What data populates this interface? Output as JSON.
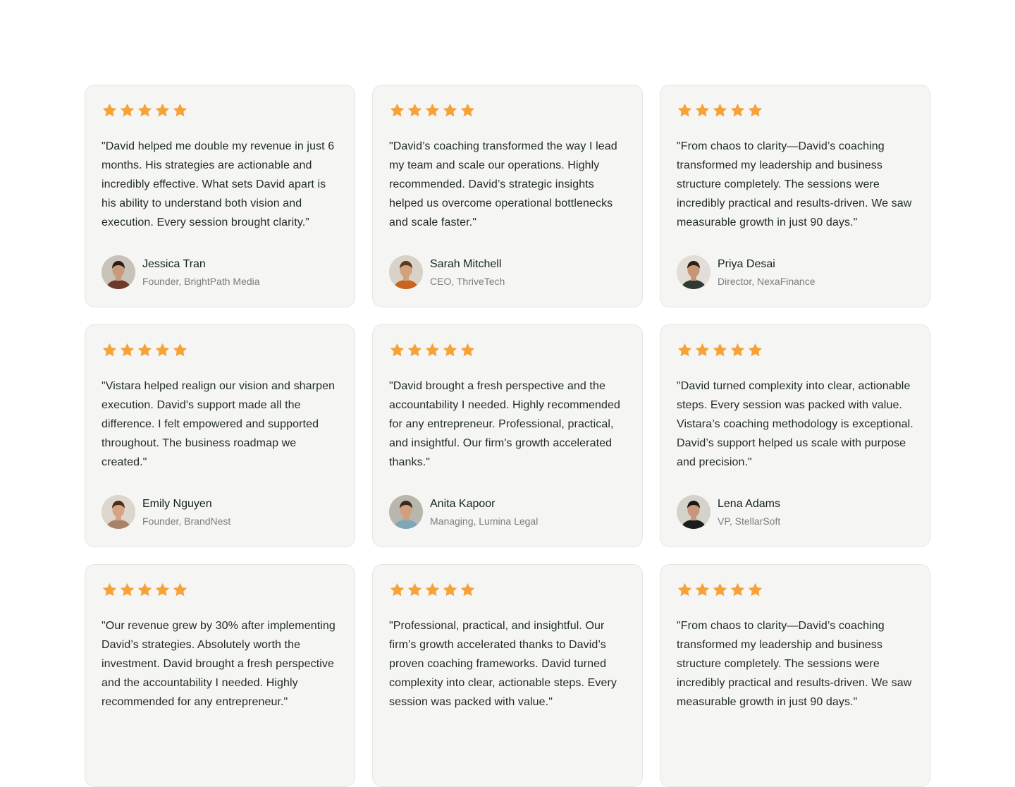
{
  "colors": {
    "star": "#f5a23a",
    "card_bg": "#f5f5f3",
    "card_border": "#e6e6e3"
  },
  "testimonials": [
    {
      "rating": 5,
      "quote": "\"David helped me double my revenue in just 6 months. His strategies are actionable and incredibly effective. What sets David apart is his ability to understand both vision and execution. Every session brought clarity.”",
      "name": "Jessica Tran",
      "role": "Founder, BrightPath Media"
    },
    {
      "rating": 5,
      "quote": "\"David’s coaching transformed the way I lead my team and scale our operations. Highly recommended. David’s strategic insights helped us overcome operational bottlenecks and scale faster.\"",
      "name": "Sarah Mitchell",
      "role": "CEO, ThriveTech"
    },
    {
      "rating": 5,
      "quote": "\"From chaos to clarity—David’s coaching transformed my leadership and business structure completely. The sessions were incredibly practical and results-driven. We saw measurable growth in just 90 days.\"",
      "name": "Priya Desai",
      "role": "Director, NexaFinance"
    },
    {
      "rating": 5,
      "quote": "\"Vistara helped realign our vision and sharpen execution. David's support made all the difference. I felt empowered and supported throughout. The business roadmap we created.\"",
      "name": "Emily Nguyen",
      "role": "Founder, BrandNest"
    },
    {
      "rating": 5,
      "quote": "\"David brought a fresh perspective and the accountability I needed. Highly recommended for any entrepreneur. Professional, practical, and insightful. Our firm's growth accelerated thanks.\"",
      "name": "Anita Kapoor",
      "role": "Managing, Lumina Legal"
    },
    {
      "rating": 5,
      "quote": "\"David turned complexity into clear, actionable steps. Every session was packed with value. Vistara’s coaching methodology is exceptional. David’s support helped us scale with purpose and precision.\"",
      "name": "Lena Adams",
      "role": "VP, StellarSoft"
    },
    {
      "rating": 5,
      "quote": "\"Our revenue grew by 30% after implementing David’s strategies. Absolutely worth the investment. David brought a fresh perspective and the accountability I needed. Highly recommended for any entrepreneur.\"",
      "name": "",
      "role": ""
    },
    {
      "rating": 5,
      "quote": "\"Professional, practical, and insightful. Our firm’s growth accelerated thanks to David’s proven coaching frameworks. David turned complexity into clear, actionable steps. Every session was packed with value.\"",
      "name": "",
      "role": ""
    },
    {
      "rating": 5,
      "quote": "\"From chaos to clarity—David’s coaching transformed my leadership and business structure completely. The sessions were incredibly practical and results-driven. We saw measurable growth in just 90 days.\"",
      "name": "",
      "role": ""
    }
  ]
}
